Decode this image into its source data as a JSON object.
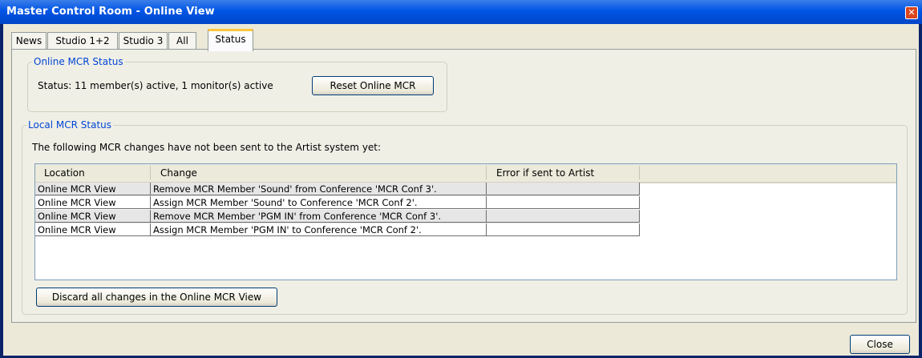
{
  "window": {
    "title": "Master Control Room - Online View",
    "close_glyph": "✕"
  },
  "tabs": [
    "News",
    "Studio 1+2",
    "Studio 3",
    "All",
    "Status"
  ],
  "active_tab": "Status",
  "online_status": {
    "legend": "Online MCR Status",
    "status_text": "Status: 11 member(s) active, 1 monitor(s) active",
    "reset_button": "Reset Online MCR"
  },
  "local_status": {
    "legend": "Local MCR Status",
    "description": "The following MCR changes have not been sent to the Artist system yet:",
    "columns": [
      "Location",
      "Change",
      "Error if sent to Artist"
    ],
    "rows": [
      [
        "Online MCR View",
        "Remove MCR Member 'Sound' from Conference 'MCR Conf 3'.",
        ""
      ],
      [
        "Online MCR View",
        "Assign MCR Member 'Sound' to Conference 'MCR Conf 2'.",
        ""
      ],
      [
        "Online MCR View",
        "Remove MCR Member 'PGM IN' from Conference 'MCR Conf 3'.",
        ""
      ],
      [
        "Online MCR View",
        "Assign MCR Member 'PGM IN' to Conference 'MCR Conf 2'.",
        ""
      ]
    ],
    "discard_button": "Discard all changes in the Online MCR View"
  },
  "footer": {
    "close_button": "Close"
  },
  "colors": {
    "titlebar": "#0055e5",
    "legend": "#0046d5",
    "face": "#ece9d8"
  }
}
